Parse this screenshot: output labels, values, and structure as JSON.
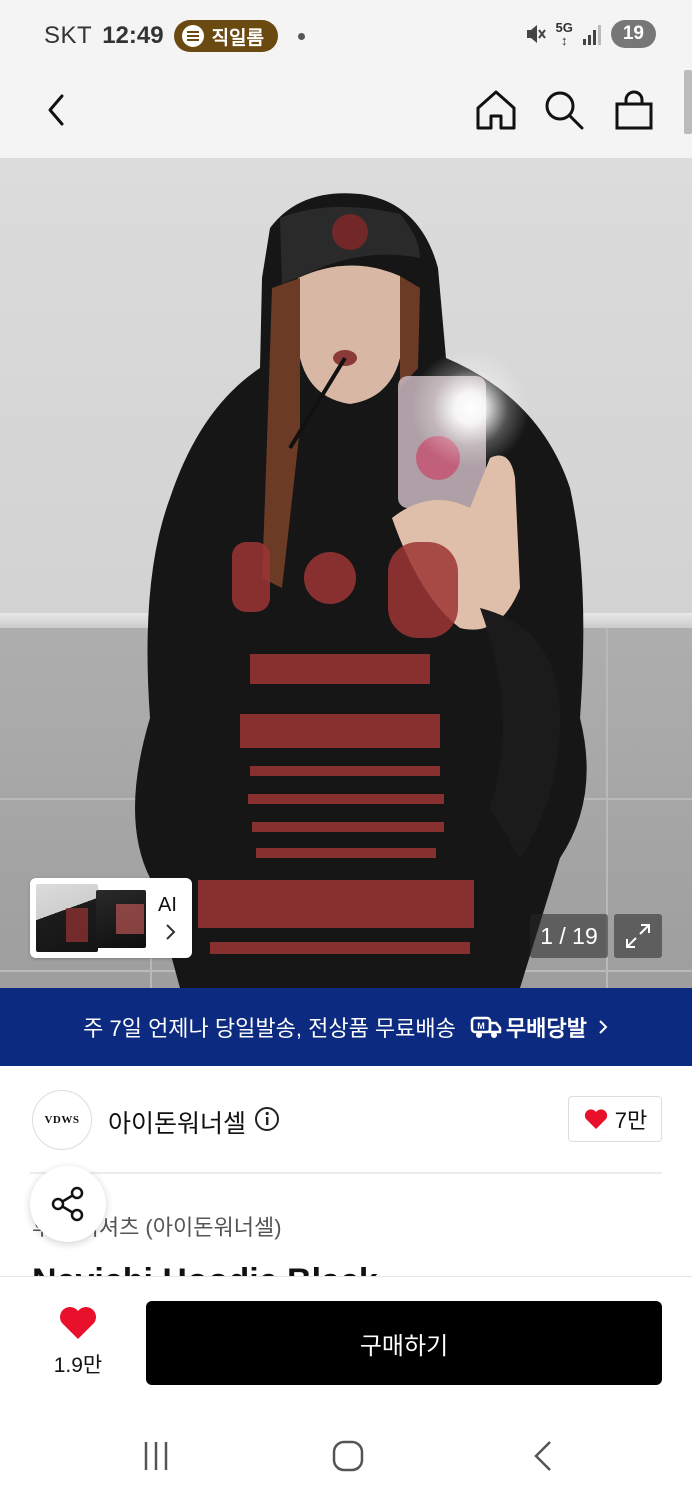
{
  "status_bar": {
    "carrier": "SKT",
    "time": "12:49",
    "pill_text": "직일롬",
    "network": "5G",
    "battery": "19",
    "icons": [
      "spotify-icon",
      "mute-icon",
      "signal-icon",
      "battery-icon"
    ]
  },
  "header": {
    "icons": [
      "back-icon",
      "home-icon",
      "search-icon",
      "shopping-bag-icon"
    ]
  },
  "gallery": {
    "ai_label": "AI",
    "counter": "1 / 19"
  },
  "promo": {
    "text": "주 7일 언제나 당일발송, 전상품 무료배송",
    "badge": "무배당발",
    "colors": {
      "background": "#0c2a80"
    }
  },
  "brand": {
    "logo_text": "VDWS",
    "name": "아이돈워너셀",
    "likes": "7만"
  },
  "product": {
    "category": "후드 티셔츠 (아이돈워너셀)",
    "title": "Nevichi Hoodie Black"
  },
  "action_bar": {
    "wish_count": "1.9만",
    "buy_label": "구매하기",
    "colors": {
      "heart": "#e8102a",
      "button": "#000000"
    }
  }
}
